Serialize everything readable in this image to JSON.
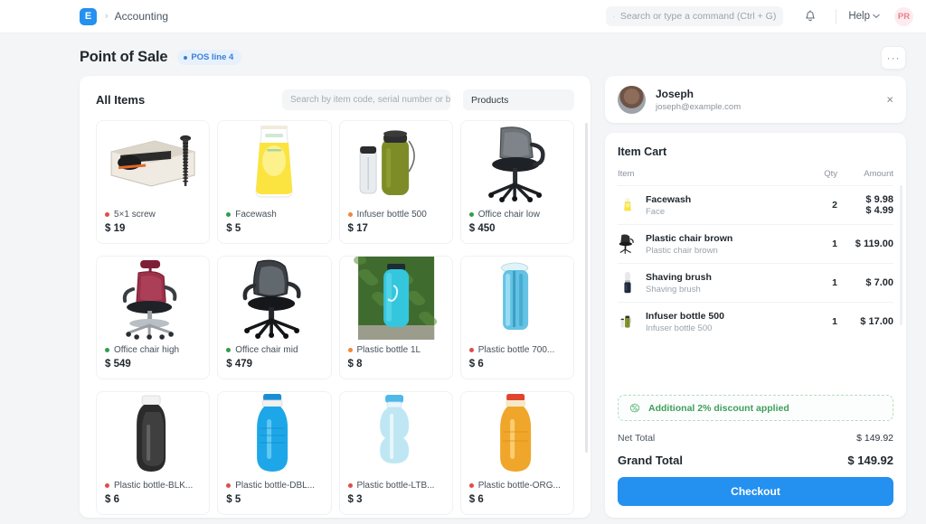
{
  "navbar": {
    "logo_text": "E",
    "breadcrumb_sep": "›",
    "breadcrumb": "Accounting",
    "search_placeholder": "Search or type a command (Ctrl + G)",
    "search_value": "",
    "help_label": "Help",
    "help_caret": "⌄",
    "user_initials": "PR"
  },
  "page": {
    "title": "Point of Sale",
    "badge": "POS line 4",
    "menu_label": "···"
  },
  "items_panel": {
    "title": "All Items",
    "search_placeholder": "Search by item code, serial number or bar",
    "search_value": "",
    "type_filter": "Products",
    "products": [
      {
        "name": "5×1 screw",
        "price": "$ 19",
        "dot": "#e24c4c",
        "art": "screwbox"
      },
      {
        "name": "Facewash",
        "price": "$ 5",
        "dot": "#2e9e4f",
        "art": "facewash"
      },
      {
        "name": "Infuser bottle 500",
        "price": "$ 17",
        "dot": "#f0883a",
        "art": "infuser"
      },
      {
        "name": "Office chair low",
        "price": "$ 450",
        "dot": "#2e9e4f",
        "art": "chairlow"
      },
      {
        "name": "Office chair high",
        "price": "$ 549",
        "dot": "#2e9e4f",
        "art": "chairhigh"
      },
      {
        "name": "Office chair mid",
        "price": "$ 479",
        "dot": "#2e9e4f",
        "art": "chairmid"
      },
      {
        "name": "Plastic bottle 1L",
        "price": "$ 8",
        "dot": "#f0883a",
        "art": "bottle1l"
      },
      {
        "name": "Plastic bottle 700...",
        "price": "$ 6",
        "dot": "#e24c4c",
        "art": "bottle700"
      },
      {
        "name": "Plastic bottle-BLK...",
        "price": "$ 6",
        "dot": "#e24c4c",
        "art": "bottleblk"
      },
      {
        "name": "Plastic bottle-DBL...",
        "price": "$ 5",
        "dot": "#e24c4c",
        "art": "bottledbl"
      },
      {
        "name": "Plastic bottle-LTB...",
        "price": "$ 3",
        "dot": "#e24c4c",
        "art": "bottleltb"
      },
      {
        "name": "Plastic bottle-ORG...",
        "price": "$ 6",
        "dot": "#e24c4c",
        "art": "bottleorg"
      }
    ]
  },
  "customer": {
    "name": "Joseph",
    "email": "joseph@example.com",
    "close_label": "×"
  },
  "cart": {
    "title": "Item Cart",
    "columns": {
      "item": "Item",
      "qty": "Qty",
      "amount": "Amount"
    },
    "rows": [
      {
        "name": "Facewash",
        "desc": "Face",
        "qty": "2",
        "amount": "$ 9.98",
        "rate": "$ 4.99",
        "art": "facewash"
      },
      {
        "name": "Plastic chair brown",
        "desc": "Plastic chair brown",
        "qty": "1",
        "amount": "$ 119.00",
        "rate": "",
        "art": "chairbrown"
      },
      {
        "name": "Shaving brush",
        "desc": "Shaving brush",
        "qty": "1",
        "amount": "$ 7.00",
        "rate": "",
        "art": "brush"
      },
      {
        "name": "Infuser bottle 500",
        "desc": "Infuser bottle 500",
        "qty": "1",
        "amount": "$ 17.00",
        "rate": "",
        "art": "infuser"
      }
    ],
    "discount_text": "Additional 2% discount applied",
    "net_total_label": "Net Total",
    "net_total_value": "$ 149.92",
    "grand_total_label": "Grand Total",
    "grand_total_value": "$ 149.92",
    "checkout_label": "Checkout"
  },
  "colors": {
    "accent": "#2490ef",
    "badge_bg": "#e7f1fd",
    "success": "#3f9e5c",
    "danger": "#e24c4c",
    "warning": "#f0883a"
  }
}
